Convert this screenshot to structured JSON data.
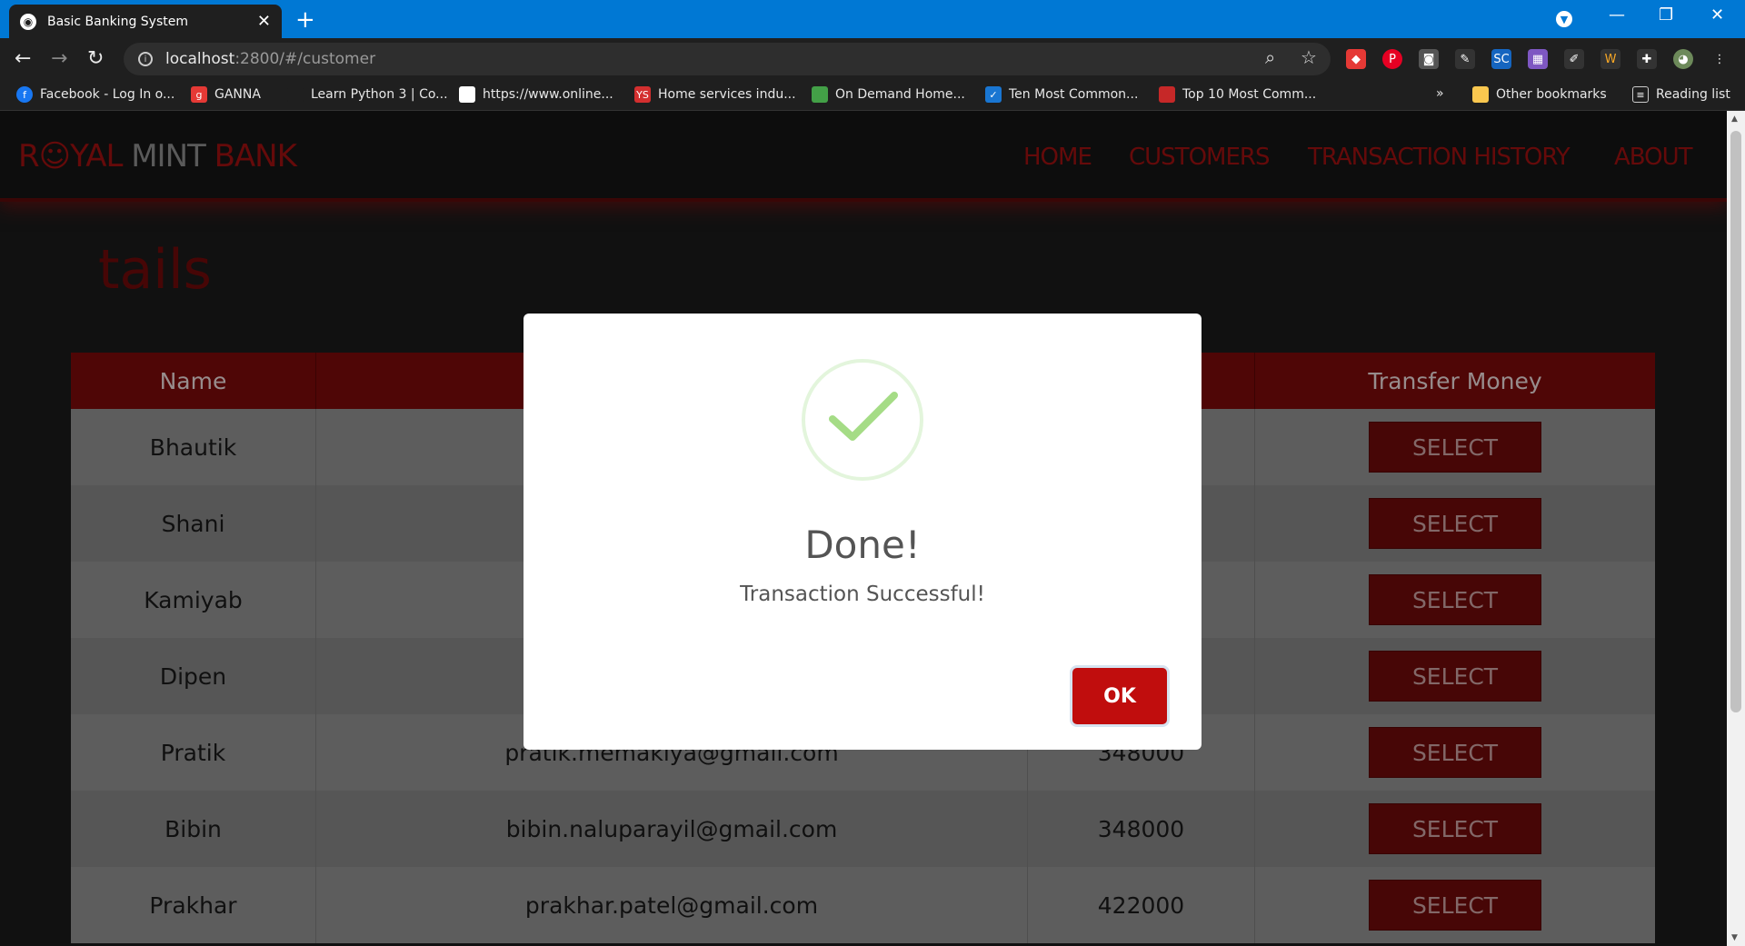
{
  "browser": {
    "tab_title": "Basic Banking System",
    "url_host": "localhost",
    "url_path": ":2800/#/customer",
    "bookmarks": [
      {
        "label": "Facebook - Log In o...",
        "color": "#1877f2",
        "glyph": "f"
      },
      {
        "label": "GANNA",
        "color": "#e53935",
        "glyph": "g"
      },
      {
        "label": "Learn Python 3 | Co...",
        "color": "#1f1f1f",
        "glyph": ""
      },
      {
        "label": "https://www.online...",
        "color": "#ffffff",
        "glyph": ""
      },
      {
        "label": "Home services indu...",
        "color": "#d32f2f",
        "glyph": "YS"
      },
      {
        "label": "On Demand Home...",
        "color": "#43a047",
        "glyph": ""
      },
      {
        "label": "Ten Most Common...",
        "color": "#1976d2",
        "glyph": "✓"
      },
      {
        "label": "Top 10 Most Comm...",
        "color": "#c62828",
        "glyph": ""
      }
    ],
    "other_bookmarks": "Other bookmarks",
    "reading_list": "Reading list",
    "overflow": "»"
  },
  "site": {
    "logo": {
      "part1": "R",
      "icon": "☺",
      "part2": "YAL ",
      "part3": "MINT ",
      "part4": "BANK"
    },
    "nav": [
      "HOME",
      "CUSTOMERS",
      "TRANSACTION HISTORY",
      "ABOUT"
    ],
    "heading": "tails"
  },
  "table": {
    "headers": [
      "Name",
      "",
      "",
      "Transfer Money"
    ],
    "rows": [
      {
        "name": "Bhautik",
        "email": "",
        "balance": "",
        "action": "SELECT"
      },
      {
        "name": "Shani",
        "email": "s",
        "balance": "",
        "action": "SELECT"
      },
      {
        "name": "Kamiyab",
        "email": "k",
        "balance": "",
        "action": "SELECT"
      },
      {
        "name": "Dipen",
        "email": "",
        "balance": "",
        "action": "SELECT"
      },
      {
        "name": "Pratik",
        "email": "pratik.memakiya@gmail.com",
        "balance": "348000",
        "action": "SELECT"
      },
      {
        "name": "Bibin",
        "email": "bibin.naluparayil@gmail.com",
        "balance": "348000",
        "action": "SELECT"
      },
      {
        "name": "Prakhar",
        "email": "prakhar.patel@gmail.com",
        "balance": "422000",
        "action": "SELECT"
      }
    ]
  },
  "modal": {
    "title": "Done!",
    "message": "Transaction Successful!",
    "ok_label": "OK",
    "icon": "check-icon",
    "check_color": "#a5dc86"
  }
}
